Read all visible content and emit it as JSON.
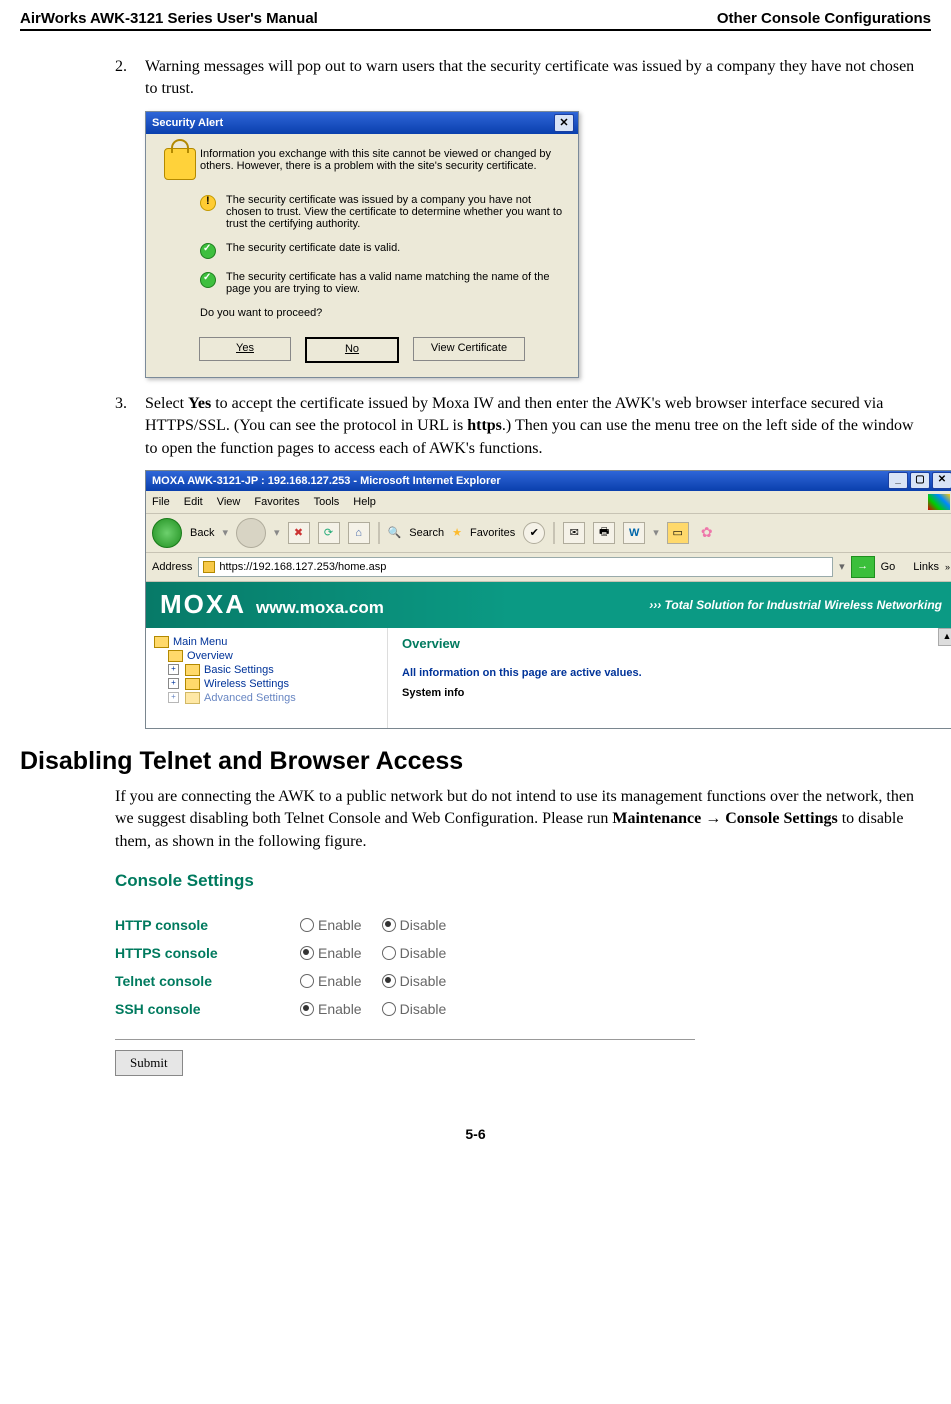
{
  "header": {
    "left": "AirWorks AWK-3121 Series User's Manual",
    "right": "Other Console Configurations"
  },
  "step2": {
    "num": "2.",
    "text": "Warning messages will pop out to warn users that the security certificate was issued by a company they have not chosen to trust."
  },
  "security_alert": {
    "title": "Security Alert",
    "intro": "Information you exchange with this site cannot be viewed or changed by others. However, there is a problem with the site's security certificate.",
    "warn": "The security certificate was issued by a company you have not chosen to trust. View the certificate to determine whether you want to trust the certifying authority.",
    "ok1": "The security certificate date is valid.",
    "ok2": "The security certificate has a valid name matching the name of the page you are trying to view.",
    "question": "Do you want to proceed?",
    "yes": "Yes",
    "no": "No",
    "view": "View Certificate"
  },
  "step3": {
    "num": "3.",
    "pre": "Select ",
    "yes": "Yes",
    "mid1": " to accept the certificate issued by Moxa IW and then enter the AWK's web browser interface secured via HTTPS/SSL. (You can see the protocol in URL is ",
    "https": "https",
    "mid2": ".) Then you can use the menu tree on the left side of the window to open the function pages to access each of AWK's functions."
  },
  "browser": {
    "title": "MOXA AWK-3121-JP : 192.168.127.253 - Microsoft Internet Explorer",
    "menu": {
      "file": "File",
      "edit": "Edit",
      "view": "View",
      "fav": "Favorites",
      "tools": "Tools",
      "help": "Help"
    },
    "tool": {
      "back": "Back",
      "search": "Search",
      "favorites": "Favorites"
    },
    "addr_label": "Address",
    "addr_value": "https://192.168.127.253/home.asp",
    "go": "Go",
    "links": "Links",
    "moxa_logo": "MOXA",
    "moxa_url": "www.moxa.com",
    "moxa_tag": "››› Total Solution for Industrial Wireless Networking",
    "tree": {
      "main": "Main Menu",
      "overview": "Overview",
      "basic": "Basic Settings",
      "wireless": "Wireless Settings",
      "adv": "Advanced Settings"
    },
    "panel": {
      "ov": "Overview",
      "info": "All information on this page are active values.",
      "sys": "System info"
    }
  },
  "section_title": "Disabling Telnet and Browser Access",
  "section_para_pre": "If you are connecting the AWK to a public network but do not intend to use its management functions over the network, then we suggest disabling both Telnet Console and Web Configuration. Please run ",
  "section_bold1": "Maintenance ",
  "section_arrow": "→",
  "section_bold2": " Console Settings",
  "section_para_post": " to disable them, as shown in the following figure.",
  "console": {
    "title": "Console Settings",
    "rows": {
      "http": "HTTP console",
      "https": "HTTPS console",
      "telnet": "Telnet console",
      "ssh": "SSH console"
    },
    "enable": "Enable",
    "disable": "Disable",
    "submit": "Submit"
  },
  "page_num": "5-6"
}
